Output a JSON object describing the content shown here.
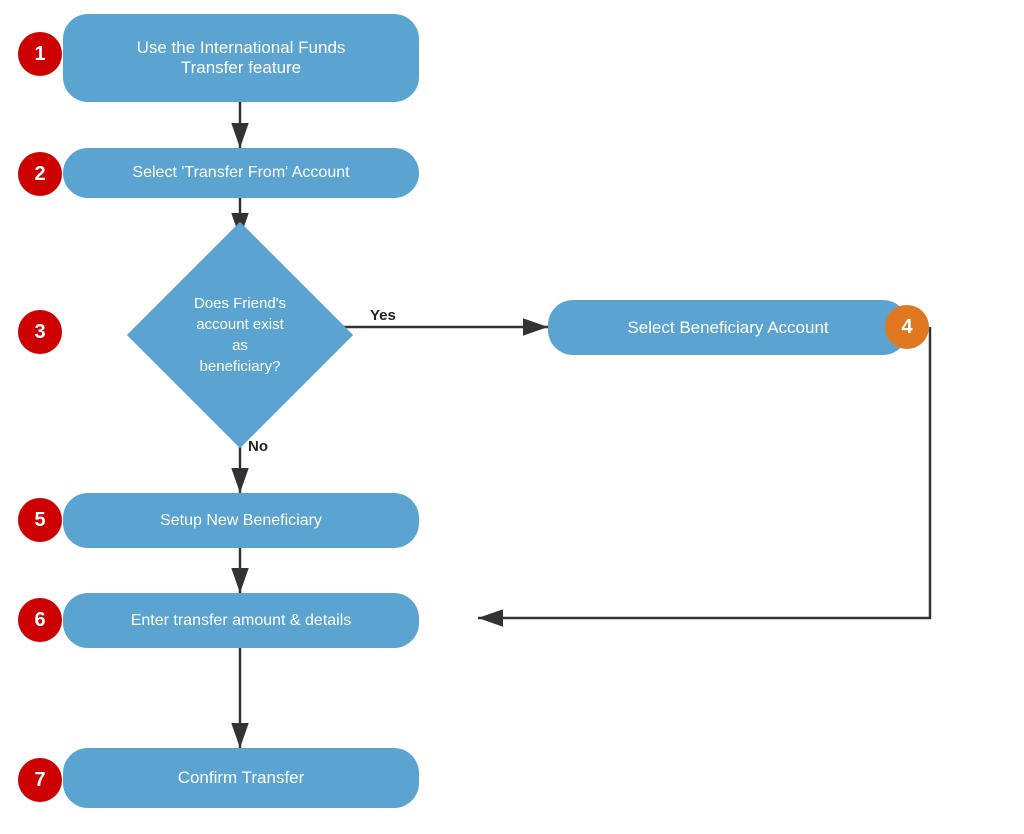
{
  "nodes": {
    "node1": {
      "label": "Use the International Funds\nTransfer feature",
      "step": "1"
    },
    "node2": {
      "label": "Select 'Transfer From' Account",
      "step": "2"
    },
    "node3": {
      "label": "Does Friend's\naccount exist\nas\nbeneficiary?",
      "step": "3"
    },
    "node4": {
      "label": "Select Beneficiary Account",
      "step": "4"
    },
    "node5": {
      "label": "Setup New Beneficiary",
      "step": "5"
    },
    "node6": {
      "label": "Enter transfer amount & details",
      "step": "6"
    },
    "node7": {
      "label": "Confirm Transfer",
      "step": "7"
    }
  },
  "labels": {
    "yes": "Yes",
    "no": "No"
  }
}
